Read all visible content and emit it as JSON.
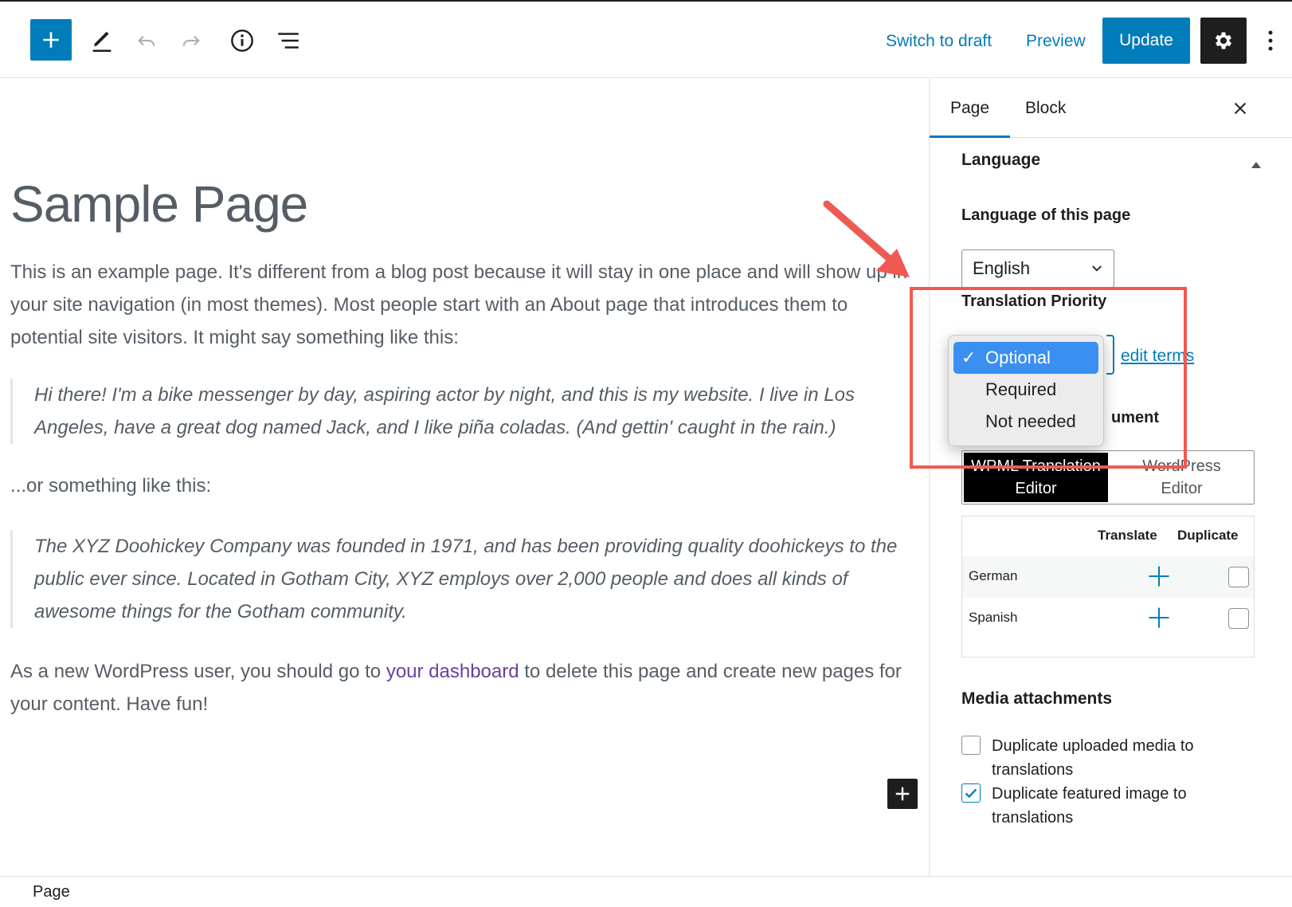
{
  "toolbar": {
    "switch_to_draft": "Switch to draft",
    "preview": "Preview",
    "update": "Update"
  },
  "content": {
    "title": "Sample Page",
    "intro": "This is an example page. It's different from a blog post because it will stay in one place and will show up in your site navigation (in most themes). Most people start with an About page that introduces them to potential site visitors. It might say something like this:",
    "quote1": "Hi there! I'm a bike messenger by day, aspiring actor by night, and this is my website. I live in Los Angeles, have a great dog named Jack, and I like piña coladas. (And gettin' caught in the rain.)",
    "or_text": "...or something like this:",
    "quote2": "The XYZ Doohickey Company was founded in 1971, and has been providing quality doohickeys to the public ever since. Located in Gotham City, XYZ employs over 2,000 people and does all kinds of awesome things for the Gotham community.",
    "outro_before": "As a new WordPress user, you should go to ",
    "outro_link": "your dashboard",
    "outro_after": " to delete this page and create new pages for your content. Have fun!"
  },
  "footer": {
    "breadcrumb": "Page"
  },
  "sidebar": {
    "tabs": [
      {
        "label": "Page"
      },
      {
        "label": "Block"
      }
    ],
    "language_section": "Language",
    "language_of_page_label": "Language of this page",
    "language_value": "English",
    "translation_priority_label": "Translation Priority",
    "edit_terms": "edit terms",
    "translate_with_partial": "ument",
    "editor_options": [
      {
        "label": "WPML Translation Editor",
        "line1": "WPML Translation",
        "line2": "Editor"
      },
      {
        "label": "WordPress Editor",
        "line1": "WordPress",
        "line2": "Editor"
      }
    ],
    "table_headers": {
      "translate": "Translate",
      "duplicate": "Duplicate"
    },
    "languages": [
      {
        "name": "German"
      },
      {
        "name": "Spanish"
      }
    ],
    "media_title": "Media attachments",
    "media_options": [
      {
        "label": "Duplicate uploaded media to translations",
        "checked": false
      },
      {
        "label": "Duplicate featured image to translations",
        "checked": true
      }
    ]
  },
  "dropdown": {
    "options": [
      {
        "label": "Optional",
        "selected": true
      },
      {
        "label": "Required",
        "selected": false
      },
      {
        "label": "Not needed",
        "selected": false
      }
    ]
  },
  "colors": {
    "accent": "#007cba",
    "annotation": "#ee5a52",
    "dropdown_selected": "#3b8ff0"
  }
}
